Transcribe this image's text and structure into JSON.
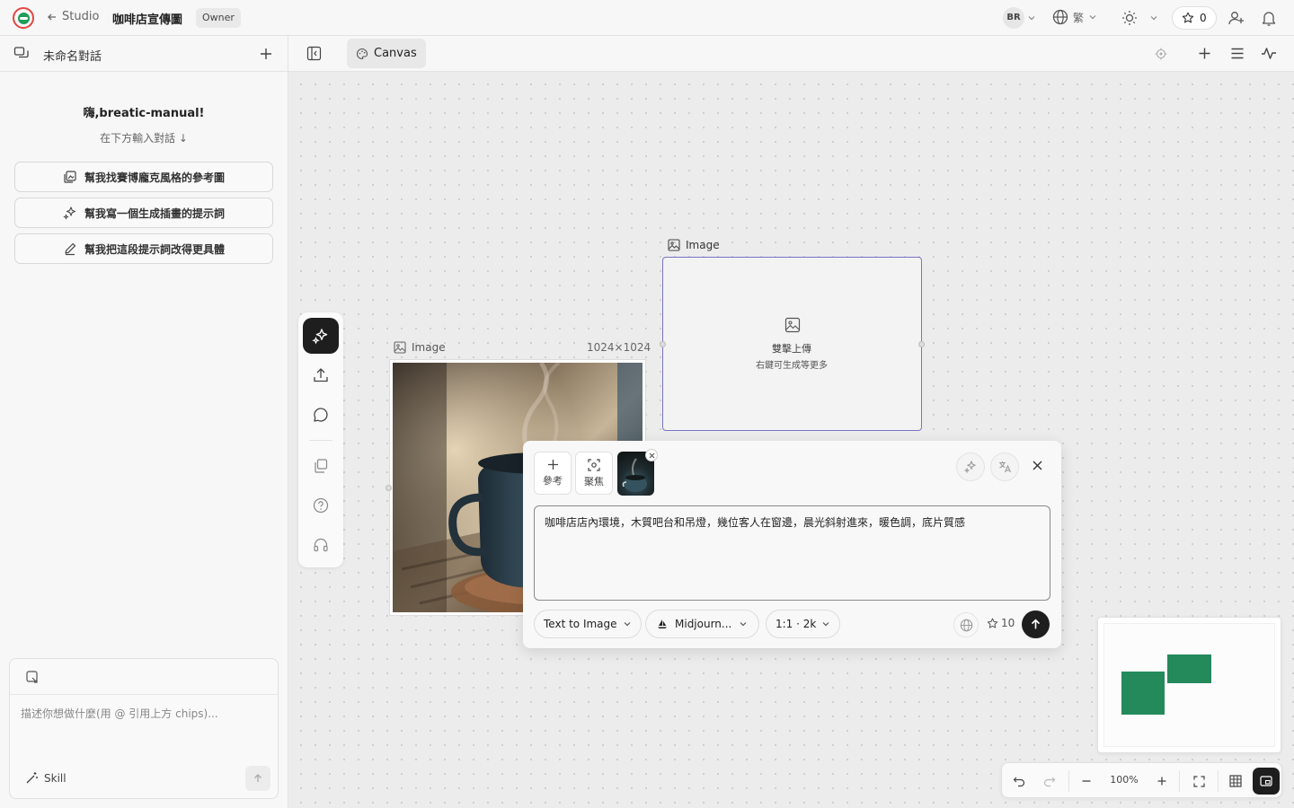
{
  "topbar": {
    "back_label": "Studio",
    "project_title": "咖啡店宣傳圖",
    "role_badge": "Owner",
    "user_initials": "BR",
    "language": "繁",
    "credits": "0"
  },
  "left_panel": {
    "conversation_title": "未命名對話",
    "greeting": "嗨,breatic-manual!",
    "subtitle": "在下方輸入對話 ↓",
    "suggestions": [
      {
        "label": "幫我找賽博龐克風格的參考圖",
        "icon": "image-search-icon"
      },
      {
        "label": "幫我寫一個生成插畫的提示詞",
        "icon": "sparkles-icon"
      },
      {
        "label": "幫我把這段提示詞改得更具體",
        "icon": "pencil-icon"
      }
    ],
    "chat_input": {
      "placeholder": "描述你想做什麼(用 @ 引用上方 chips)...",
      "skill_label": "Skill"
    }
  },
  "canvas_bar": {
    "tab_label": "Canvas"
  },
  "canvas": {
    "image_node": {
      "label": "Image",
      "dimensions": "1024×1024"
    },
    "empty_node": {
      "label": "Image",
      "primary_hint": "雙擊上傳",
      "secondary_hint": "右鍵可生成等更多"
    }
  },
  "generation_panel": {
    "reference_label": "參考",
    "focus_label": "聚焦",
    "prompt_text": "咖啡店店內環境，木質吧台和吊燈，幾位客人在窗邊，晨光斜射進來，暖色調，底片質感",
    "mode": "Text to Image",
    "model": "Midjourn...",
    "aspect": "1:1 · 2k",
    "cost": "10"
  },
  "zoom": {
    "level": "100%"
  },
  "colors": {
    "accent_purple": "#7b74c4",
    "minimap_green": "#248a5c",
    "logo_red": "#e2463f",
    "logo_green": "#1f9d5a"
  }
}
